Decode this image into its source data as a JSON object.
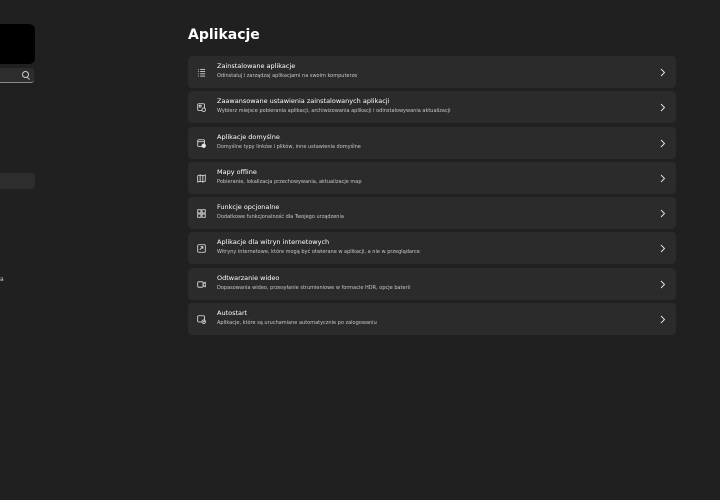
{
  "nav": {
    "fragment_text": "a"
  },
  "page": {
    "title": "Aplikacje"
  },
  "items": [
    {
      "title": "Zainstalowane aplikacje",
      "desc": "Odinstaluj i zarządzaj aplikacjami na swoim komputerze",
      "icon": "installed-apps-icon"
    },
    {
      "title": "Zaawansowane ustawienia zainstalowanych aplikacji",
      "desc": "Wybierz miejsce pobierania aplikacji, archiwizowania aplikacji i odinstalowywania aktualizacji",
      "icon": "advanced-app-settings-icon"
    },
    {
      "title": "Aplikacje domyślne",
      "desc": "Domyślne typy linków i plików, inne ustawienia domyślne",
      "icon": "default-apps-icon"
    },
    {
      "title": "Mapy offline",
      "desc": "Pobieranie, lokalizacja przechowywania, aktualizacje map",
      "icon": "offline-maps-icon"
    },
    {
      "title": "Funkcje opcjonalne",
      "desc": "Dodatkowe funkcjonalność dla Twojego urządzenia",
      "icon": "optional-features-icon"
    },
    {
      "title": "Aplikacje dla witryn internetowych",
      "desc": "Witryny internetowe, które mogą być otwierane w aplikacji, a nie w przeglądarce",
      "icon": "apps-for-websites-icon"
    },
    {
      "title": "Odtwarzanie wideo",
      "desc": "Dopasowania wideo, przesyłanie strumieniowe w formacie HDR, opcje baterii",
      "icon": "video-playback-icon"
    },
    {
      "title": "Autostart",
      "desc": "Aplikacje, które są uruchamiane automatycznie po zalogowaniu",
      "icon": "startup-icon"
    }
  ],
  "colors": {
    "background": "#202020",
    "card": "#2b2b2b",
    "text_primary": "#ffffff",
    "text_secondary": "#c8c8c8"
  }
}
